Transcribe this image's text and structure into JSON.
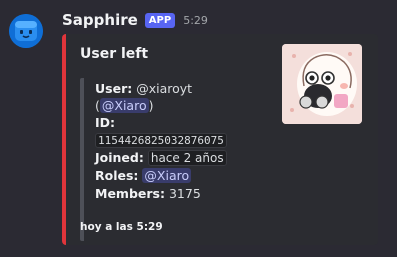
{
  "message": {
    "username": "Sapphire",
    "badge": "APP",
    "time": "5:29",
    "avatar_icon": "sapphire-bot-avatar",
    "accent_color": "#e0353b"
  },
  "embed": {
    "title": "User left",
    "user_label": "User:",
    "user_value": "@xiaroyt",
    "user_mention_open": "(",
    "user_mention": "@Xiaro",
    "user_mention_close": ")",
    "id_label": "ID:",
    "id_value": "1154426825032876075",
    "joined_label": "Joined:",
    "joined_value": "hace 2 años",
    "roles_label": "Roles:",
    "roles_value": "@Xiaro",
    "members_label": "Members:",
    "members_value": "3175",
    "footer": "hoy a las 5:29",
    "thumbnail_icon": "user-avatar-thumbnail"
  }
}
